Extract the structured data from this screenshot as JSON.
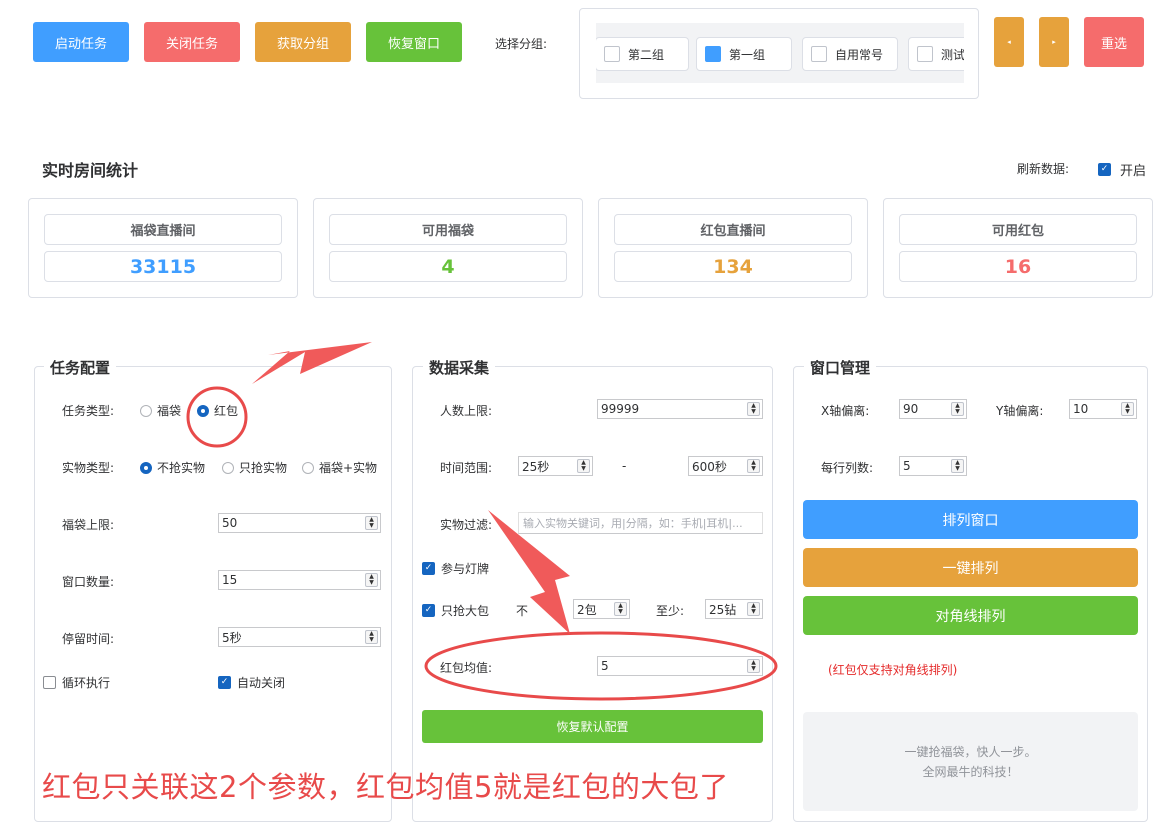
{
  "toolbar": {
    "start_task": "启动任务",
    "close_task": "关闭任务",
    "get_groups": "获取分组",
    "restore_window": "恢复窗口",
    "select_group_label": "选择分组:",
    "groups": [
      {
        "label": "第二组",
        "checked": false
      },
      {
        "label": "第一组",
        "checked": true
      },
      {
        "label": "自用常号",
        "checked": false
      },
      {
        "label": "测试",
        "checked": false
      }
    ],
    "prev_glyph": "◂",
    "next_glyph": "▸",
    "reset": "重选"
  },
  "stats": {
    "title": "实时房间统计",
    "refresh_label": "刷新数据:",
    "refresh_toggle": "开启",
    "refresh_enabled": true,
    "cards": [
      {
        "label": "福袋直播间",
        "value": "33115",
        "color": "#409eff"
      },
      {
        "label": "可用福袋",
        "value": "4",
        "color": "#67c23a"
      },
      {
        "label": "红包直播间",
        "value": "134",
        "color": "#e6a23c"
      },
      {
        "label": "可用红包",
        "value": "16",
        "color": "#f56c6c"
      }
    ]
  },
  "task_config": {
    "title": "任务配置",
    "task_type_label": "任务类型:",
    "task_type_options": [
      "福袋",
      "红包"
    ],
    "task_type_selected": "红包",
    "item_type_label": "实物类型:",
    "item_type_options": [
      "不抢实物",
      "只抢实物",
      "福袋+实物"
    ],
    "item_type_selected": "不抢实物",
    "bag_limit_label": "福袋上限:",
    "bag_limit_value": "50",
    "window_count_label": "窗口数量:",
    "window_count_value": "15",
    "stay_time_label": "停留时间:",
    "stay_time_value": "5秒",
    "loop_label": "循环执行",
    "loop_checked": false,
    "auto_close_label": "自动关闭",
    "auto_close_checked": true
  },
  "data_collect": {
    "title": "数据采集",
    "people_limit_label": "人数上限:",
    "people_limit_value": "99999",
    "time_range_label": "时间范围:",
    "time_from": "25秒",
    "time_sep": "-",
    "time_to": "600秒",
    "item_filter_label": "实物过滤:",
    "item_filter_placeholder": "输入实物关键词，用|分隔，如：手机|耳机|...",
    "lamp_label": "参与灯牌",
    "lamp_checked": true,
    "big_only_label": "只抢大包",
    "big_only_checked": true,
    "not_label_partial": "不",
    "big_value": "2包",
    "at_least_label": "至少:",
    "at_least_value": "25钻",
    "red_avg_label": "红包均值:",
    "red_avg_value": "5",
    "restore_defaults": "恢复默认配置"
  },
  "window_mgmt": {
    "title": "窗口管理",
    "x_offset_label": "X轴偏离:",
    "x_offset_value": "90",
    "y_offset_label": "Y轴偏离:",
    "y_offset_value": "10",
    "per_row_label": "每行列数:",
    "per_row_value": "5",
    "arrange_btn": "排列窗口",
    "one_click_btn": "一键排列",
    "diagonal_btn": "对角线排列",
    "note": "(红包仅支持对角线排列)",
    "info_line1": "一键抢福袋，快人一步。",
    "info_line2": "全网最牛的科技！"
  },
  "annotation": {
    "text": "红包只关联这2个参数，红包均值5就是红包的大包了",
    "color": "#e84a4a"
  }
}
